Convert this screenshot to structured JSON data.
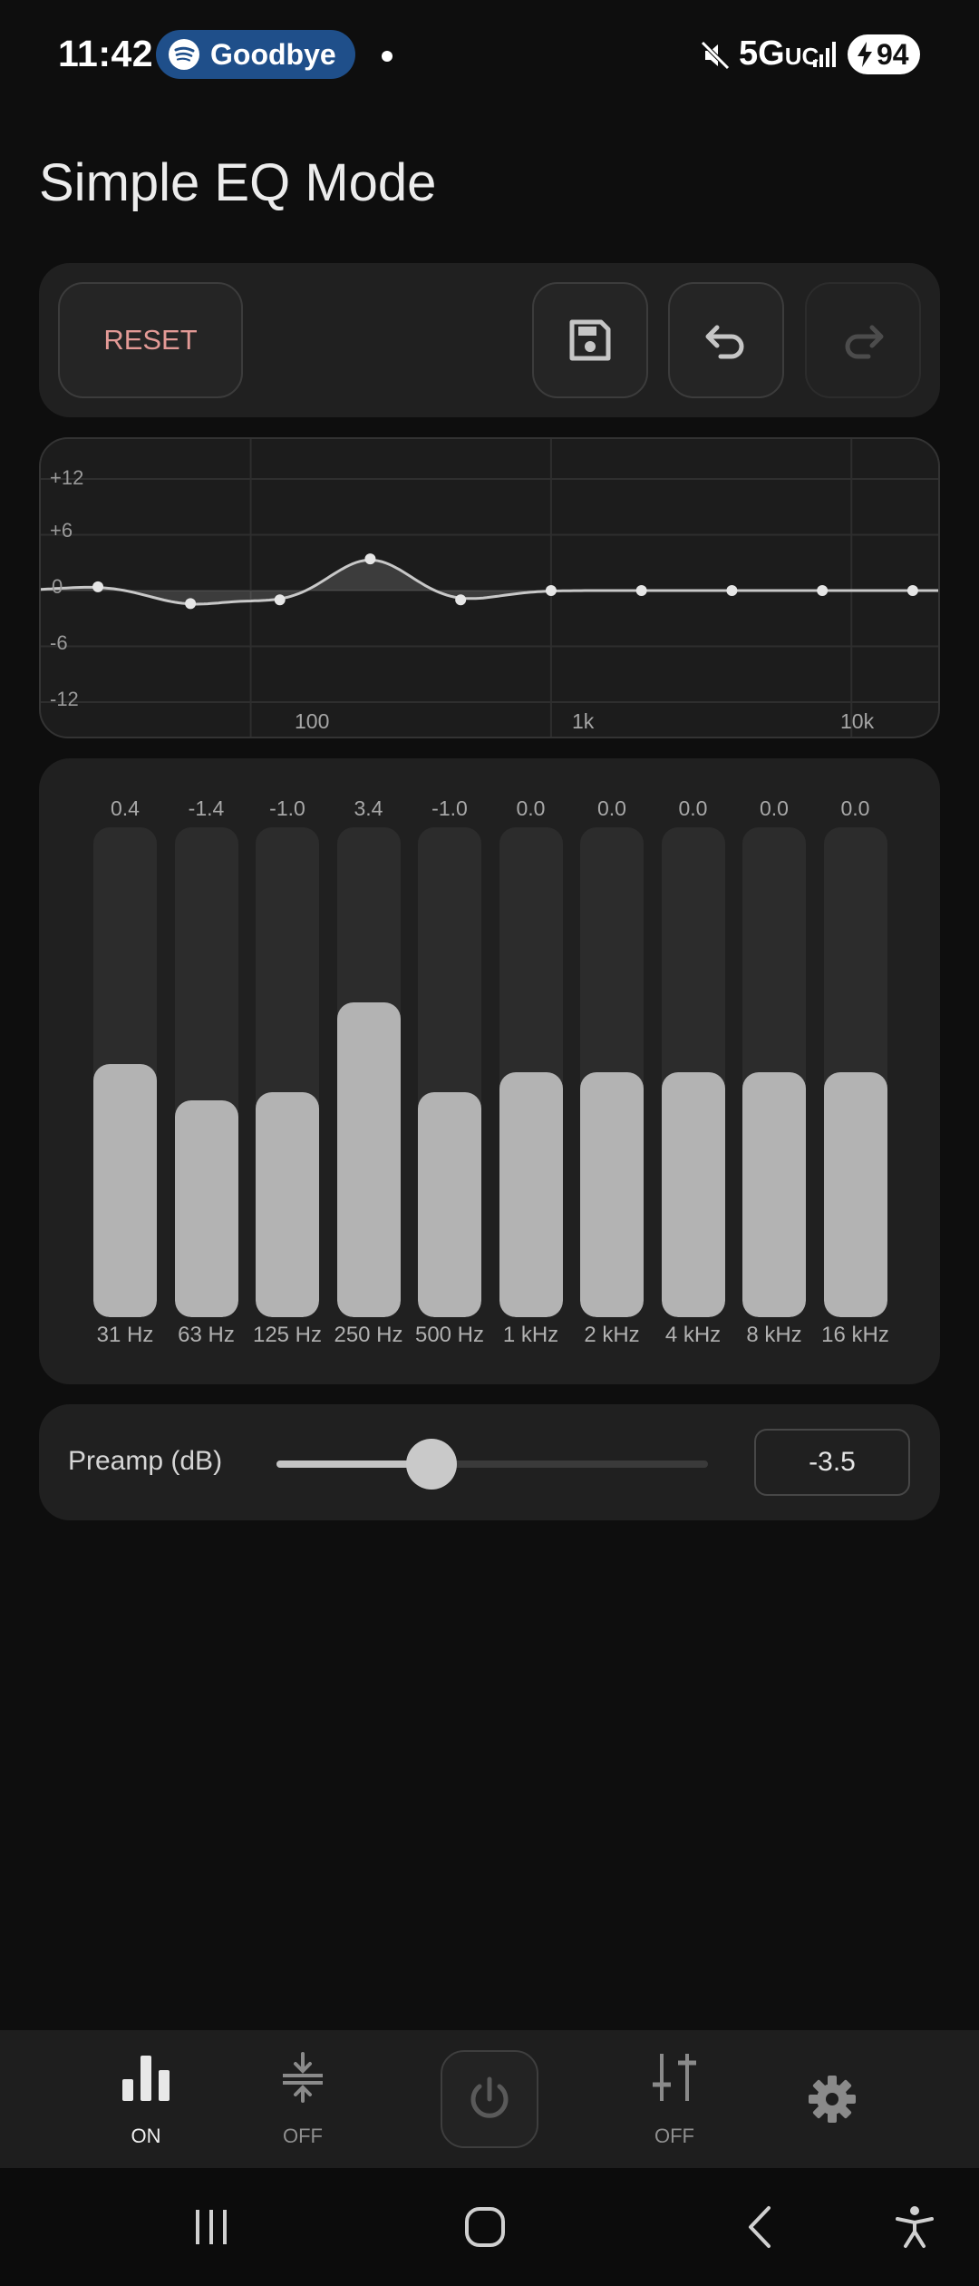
{
  "status_bar": {
    "time": "11:42",
    "media_text": "Goodbye",
    "network": "5G",
    "network_sub": "UC",
    "battery": "94"
  },
  "page_title": "Simple EQ Mode",
  "toolbar": {
    "reset_label": "RESET",
    "save_icon": "save-icon",
    "undo_icon": "undo-icon",
    "redo_icon": "redo-icon",
    "redo_enabled": false
  },
  "curve": {
    "y_ticks": [
      "+12",
      "+6",
      "0",
      "-6",
      "-12"
    ],
    "x_ticks": [
      "100",
      "1k",
      "10k"
    ],
    "y_range_db": [
      -12,
      12
    ],
    "x_range_hz": [
      20,
      20000
    ],
    "log_x": true
  },
  "bands": [
    {
      "freq": "31 Hz",
      "value": "0.4",
      "gain": 0.4
    },
    {
      "freq": "63 Hz",
      "value": "-1.4",
      "gain": -1.4
    },
    {
      "freq": "125 Hz",
      "value": "-1.0",
      "gain": -1.0
    },
    {
      "freq": "250 Hz",
      "value": "3.4",
      "gain": 3.4
    },
    {
      "freq": "500 Hz",
      "value": "-1.0",
      "gain": -1.0
    },
    {
      "freq": "1 kHz",
      "value": "0.0",
      "gain": 0.0
    },
    {
      "freq": "2 kHz",
      "value": "0.0",
      "gain": 0.0
    },
    {
      "freq": "4 kHz",
      "value": "0.0",
      "gain": 0.0
    },
    {
      "freq": "8 kHz",
      "value": "0.0",
      "gain": 0.0
    },
    {
      "freq": "16 kHz",
      "value": "0.0",
      "gain": 0.0
    }
  ],
  "band_hz": [
    31,
    63,
    125,
    250,
    500,
    1000,
    2000,
    4000,
    8000,
    16000
  ],
  "band_range_db": [
    -12,
    12
  ],
  "preamp": {
    "label": "Preamp (dB)",
    "value": "-3.5",
    "level_fraction": 0.36
  },
  "bottom_nav": {
    "items": [
      {
        "icon": "equalizer-icon",
        "label": "ON"
      },
      {
        "icon": "compressor-icon",
        "label": "OFF"
      },
      {
        "icon": "power-icon",
        "label": ""
      },
      {
        "icon": "sliders-icon",
        "label": "OFF"
      },
      {
        "icon": "gear-icon",
        "label": ""
      }
    ]
  },
  "colors": {
    "background": "#0e0e0e",
    "card": "#202020",
    "bar_fill": "#b3b3b3",
    "reset_text": "#e39a96",
    "media_pill": "#1f4f8a"
  }
}
